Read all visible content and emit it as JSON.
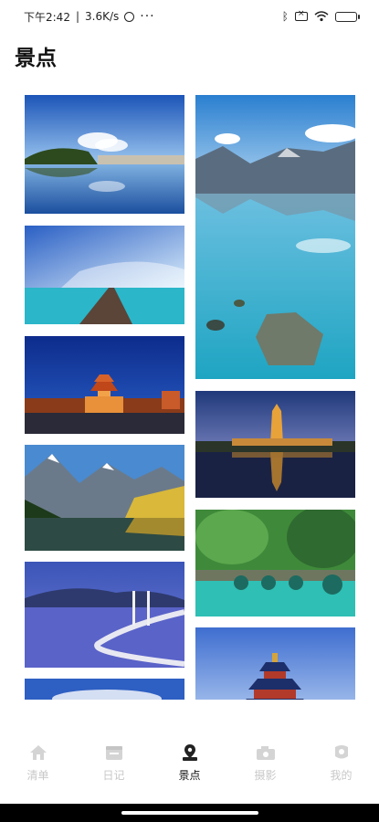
{
  "status_bar": {
    "time": "下午2:42",
    "net_speed": "3.6K/s",
    "icons": [
      "alarm-icon",
      "more-dots-icon",
      "bluetooth-icon",
      "sim-icon",
      "wifi-icon",
      "battery-icon"
    ]
  },
  "header": {
    "title": "景点"
  },
  "gallery": {
    "photos": [
      {
        "name": "lake-city-photo"
      },
      {
        "name": "mountain-lake-photo"
      },
      {
        "name": "pier-sea-photo"
      },
      {
        "name": "bell-tower-photo"
      },
      {
        "name": "pagoda-night-photo"
      },
      {
        "name": "alpine-forest-photo"
      },
      {
        "name": "stone-bridge-photo"
      },
      {
        "name": "sea-bridge-photo"
      },
      {
        "name": "temple-of-heaven-photo"
      },
      {
        "name": "sky-photo"
      }
    ]
  },
  "bottom_nav": {
    "items": [
      {
        "label": "清单",
        "icon": "home-icon",
        "active": false
      },
      {
        "label": "日记",
        "icon": "diary-icon",
        "active": false
      },
      {
        "label": "景点",
        "icon": "location-pin-icon",
        "active": true
      },
      {
        "label": "摄影",
        "icon": "camera-icon",
        "active": false
      },
      {
        "label": "我的",
        "icon": "profile-icon",
        "active": false
      }
    ]
  },
  "colors": {
    "active": "#111111",
    "inactive": "#c8c8c8"
  }
}
